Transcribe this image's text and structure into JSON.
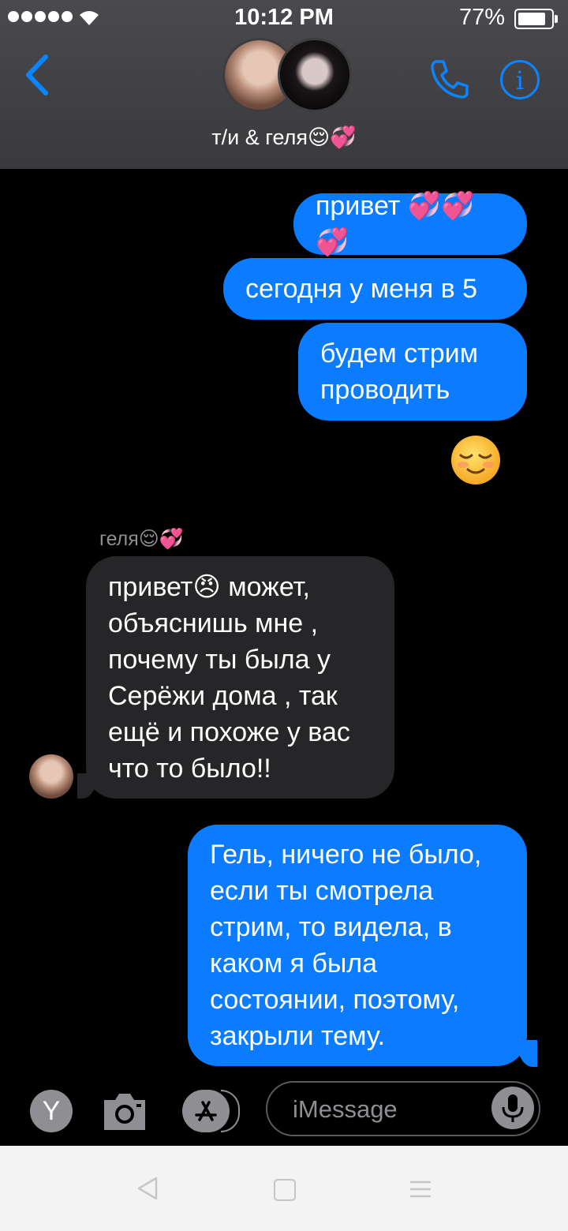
{
  "status_bar": {
    "time": "10:12 PM",
    "battery": "77%"
  },
  "header": {
    "title": "т/и & геля😌💞"
  },
  "messages": {
    "m1": "привет 💞💞💞",
    "m2": "сегодня у меня в 5",
    "m3": "будем стрим проводить",
    "m4": "😌",
    "sender": "геля😌💞",
    "m5": "привет😠 может, объяснишь мне , почему ты была у Серёжи дома , так ещё и похоже у вас что то было!!",
    "m6": "Гель, ничего не было, если ты смотрела стрим, то видела, в каком я была состоянии, поэтому, закрыли тему."
  },
  "input": {
    "placeholder": "iMessage",
    "app_letter": "Y"
  },
  "colors": {
    "accent": "#0a84ff",
    "outgoing_bubble": "#0b7bff",
    "incoming_bubble": "#262628"
  }
}
